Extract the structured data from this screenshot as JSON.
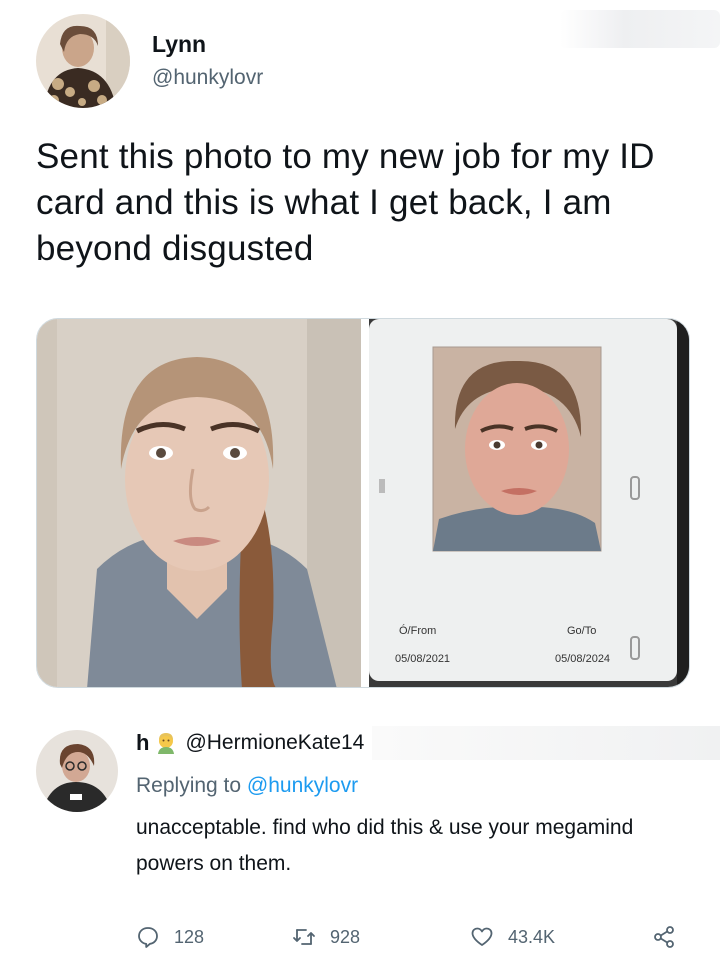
{
  "tweet": {
    "display_name": "Lynn",
    "handle": "@hunkylovr",
    "text": "Sent this photo to my new job for my ID card and this is what I get back, I am beyond disgusted",
    "id_card": {
      "from_label": "Ó/From",
      "from_date": "05/08/2021",
      "to_label": "Go/To",
      "to_date": "05/08/2024"
    }
  },
  "reply": {
    "display_name": "h",
    "handle": "@HermioneKate14",
    "replying_prefix": "Replying to",
    "replying_to": "@hunkylovr",
    "text": "unacceptable. find who did this & use your megamind powers on them."
  },
  "actions": {
    "replies": "128",
    "retweets": "928",
    "likes": "43.4K"
  },
  "icons": {
    "reply": "speech-bubble-icon",
    "retweet": "retweet-icon",
    "like": "heart-icon",
    "share": "share-icon",
    "emoji": "person-emoji-icon"
  },
  "colors": {
    "link": "#1d9bf0",
    "secondary_text": "#536471",
    "primary_text": "#0f1419"
  }
}
